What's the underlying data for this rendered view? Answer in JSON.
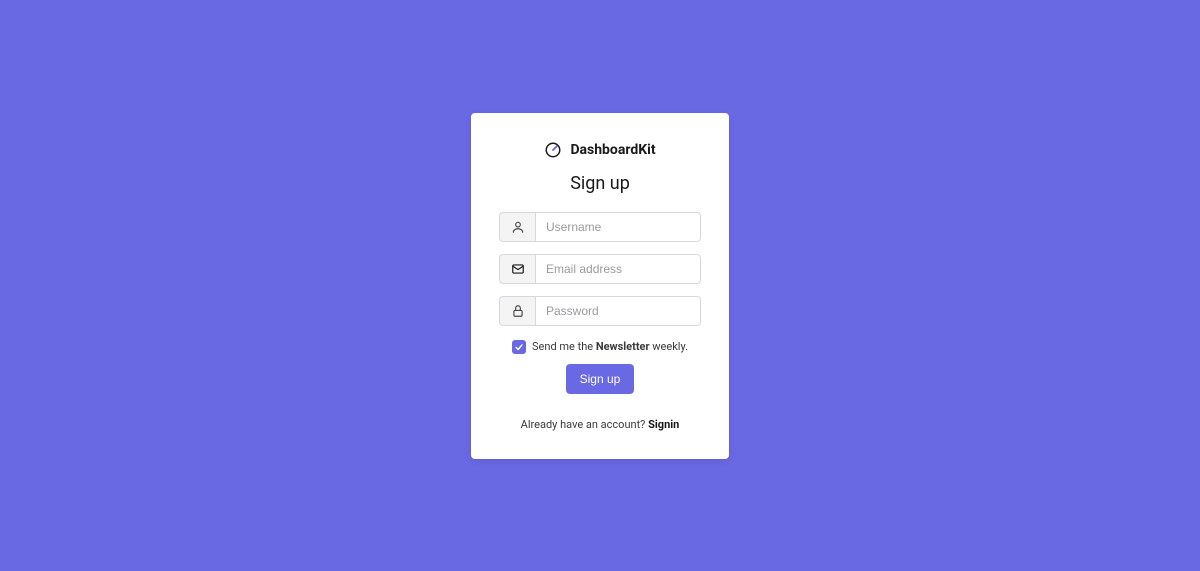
{
  "brand": {
    "name": "DashboardKit"
  },
  "heading": "Sign up",
  "form": {
    "username": {
      "placeholder": "Username",
      "value": ""
    },
    "email": {
      "placeholder": "Email address",
      "value": ""
    },
    "password": {
      "placeholder": "Password",
      "value": ""
    },
    "newsletter": {
      "checked": true,
      "label_prefix": "Send me the ",
      "label_strong": "Newsletter",
      "label_suffix": " weekly."
    },
    "submit_label": "Sign up"
  },
  "footer": {
    "prompt": "Already have an account? ",
    "link_label": "Signin"
  },
  "colors": {
    "background": "#6a69e4",
    "accent": "#6a69e4"
  }
}
